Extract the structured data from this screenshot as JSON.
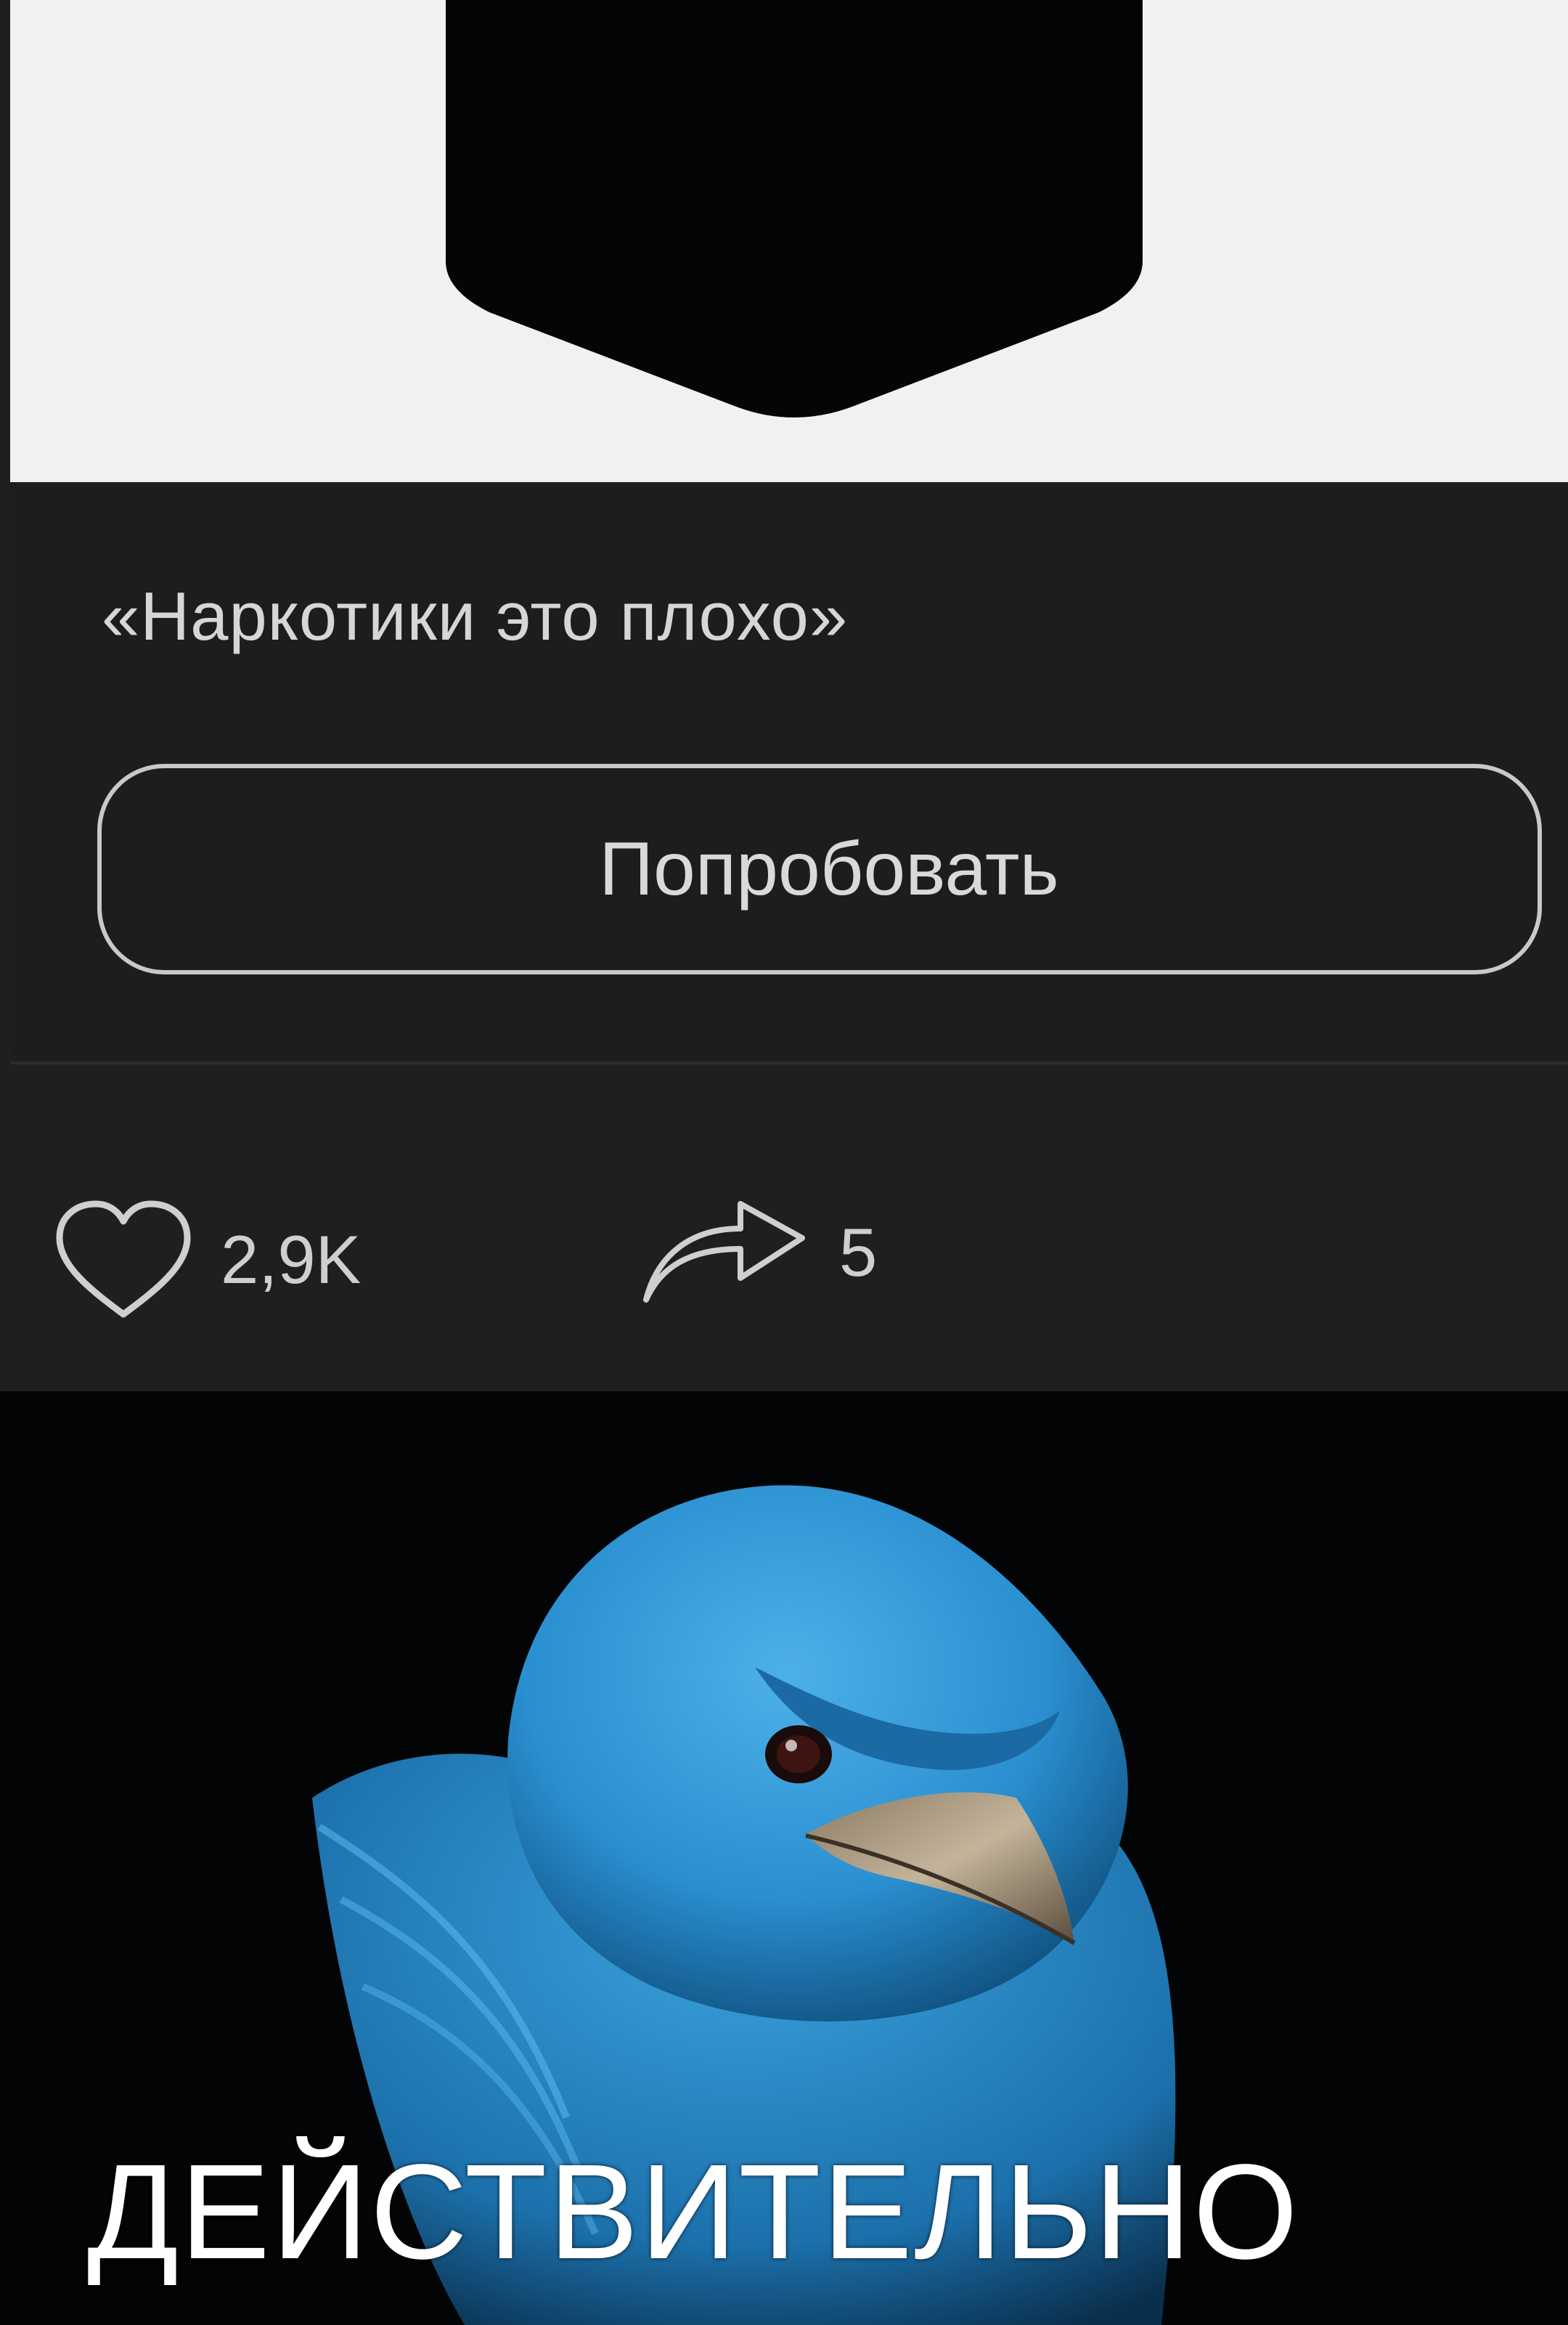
{
  "post": {
    "quote": "«Наркотики это плохо»",
    "button_label": "Попробовать"
  },
  "actions": {
    "likes_count": "2,9K",
    "shares_count": "5",
    "like_icon": "heart-icon",
    "share_icon": "share-arrow-icon"
  },
  "meme": {
    "caption": "ДЕЙСТВИТЕЛЬНО",
    "image_subject": "angry-blue-bird"
  },
  "colors": {
    "card_background": "#1d1d1f",
    "image_background": "#f0f1f2",
    "text": "#d6d6d8",
    "bird_blue": "#2a8fd0"
  }
}
